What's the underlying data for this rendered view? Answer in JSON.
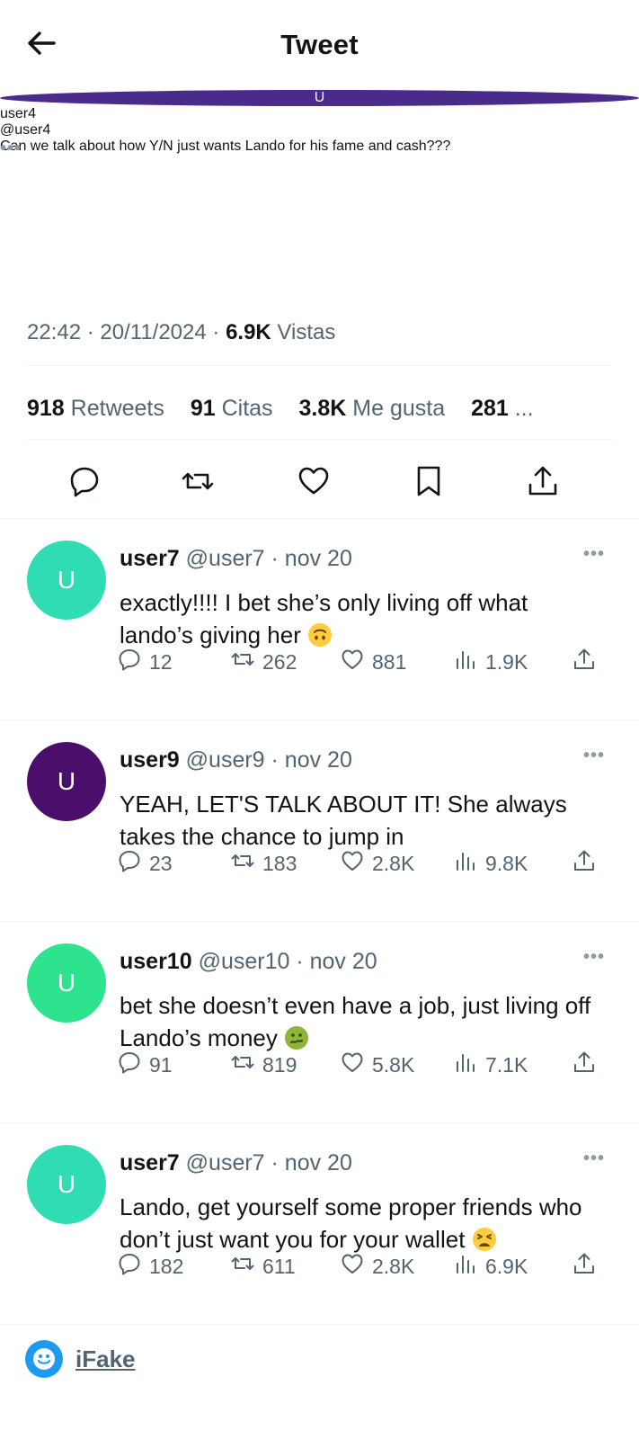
{
  "header": {
    "title": "Tweet"
  },
  "tweet": {
    "avatar_letter": "U",
    "avatar_color": "#4a2a8a",
    "name": "user4",
    "handle": "@user4",
    "text": "Can we talk about how Y/N just wants Lando for his fame and cash???",
    "time": "22:42 · 20/11/2024 · ",
    "views_count": "6.9K",
    "views_label": " Vistas",
    "stats": [
      {
        "count": "918",
        "label": " Retweets"
      },
      {
        "count": "91",
        "label": " Citas"
      },
      {
        "count": "3.8K",
        "label": " Me gusta"
      },
      {
        "count": "281",
        "label": " ..."
      }
    ]
  },
  "replies": [
    {
      "avatar_letter": "U",
      "avatar_color": "#2fdcb4",
      "name": "user7",
      "handle": " @user7 · nov 20",
      "text": "exactly!!!! I bet she’s only living off what lando’s giving her",
      "emoji": "upside-down-face",
      "replies": "12",
      "retweets": "262",
      "likes": "881",
      "views": "1.9K"
    },
    {
      "avatar_letter": "U",
      "avatar_color": "#4a0e6b",
      "name": "user9",
      "handle": " @user9 · nov 20",
      "text": "YEAH, LET'S TALK ABOUT IT! She always takes the chance to jump in",
      "emoji": "",
      "replies": "23",
      "retweets": "183",
      "likes": "2.8K",
      "views": "9.8K"
    },
    {
      "avatar_letter": "U",
      "avatar_color": "#2ee38e",
      "name": "user10",
      "handle": " @user10 · nov 20",
      "text": "bet she doesn’t even have a job, just living off Lando’s money",
      "emoji": "nauseated-face",
      "replies": "91",
      "retweets": "819",
      "likes": "5.8K",
      "views": "7.1K"
    },
    {
      "avatar_letter": "U",
      "avatar_color": "#2fdcb4",
      "name": "user7",
      "handle": " @user7 · nov 20",
      "text": "Lando, get yourself some proper friends who don’t just want you for your wallet",
      "emoji": "tired-face",
      "replies": "182",
      "retweets": "611",
      "likes": "2.8K",
      "views": "6.9K"
    }
  ],
  "footer": {
    "brand": "iFake"
  }
}
